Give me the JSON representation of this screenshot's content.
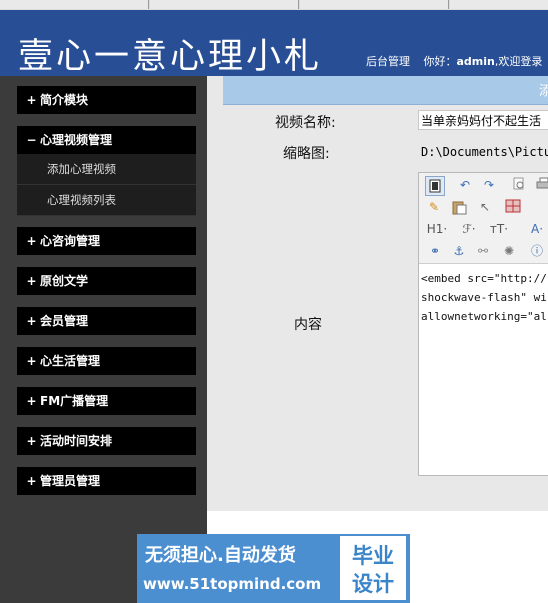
{
  "header": {
    "site_title": "壹心一意心理小札",
    "nav_admin": "后台管理",
    "greeting_prefix": "你好：",
    "username": "admin",
    "greeting_suffix": ",欢迎登录"
  },
  "sidebar": {
    "items": [
      {
        "sign": "+",
        "label": "简介模块"
      },
      {
        "sign": "−",
        "label": "心理视频管理"
      },
      {
        "sign": "+",
        "label": "心咨询管理"
      },
      {
        "sign": "+",
        "label": "原创文学"
      },
      {
        "sign": "+",
        "label": "会员管理"
      },
      {
        "sign": "+",
        "label": "心生活管理"
      },
      {
        "sign": "+",
        "label": "FM广播管理"
      },
      {
        "sign": "+",
        "label": "活动时间安排"
      },
      {
        "sign": "+",
        "label": "管理员管理"
      }
    ],
    "subitems": [
      {
        "label": "添加心理视频"
      },
      {
        "label": "心理视频列表"
      }
    ]
  },
  "main": {
    "bar_text": "添",
    "form": {
      "name_label": "视频名称:",
      "name_value": "当单亲妈妈付不起生活",
      "thumb_label": "缩略图:",
      "thumb_value": "D:\\Documents\\Pictur",
      "content_label": "内容"
    },
    "editor": {
      "toolbar": [
        [
          "source-icon",
          "undo-icon",
          "redo-icon",
          "preview-icon",
          "print-icon"
        ],
        [
          "cleanup-icon",
          "paste-icon",
          "select-icon",
          "table-icon"
        ],
        [
          "heading-icon",
          "font-family-icon",
          "font-size-icon",
          "font-color-icon"
        ],
        [
          "link-icon",
          "anchor-icon",
          "unlink-icon",
          "flash-icon",
          "help-icon"
        ]
      ],
      "toolbar_glyphs": {
        "heading": "H1·",
        "font_family": "ℱ·",
        "font_size": "тT·",
        "font_color": "A·"
      },
      "content_lines": [
        "<embed src=\"http://",
        "shockwave-flash\" wi",
        "allownetworking=\"al"
      ]
    }
  },
  "watermark": {
    "slogan": "无须担心.自动发货",
    "url": "www.51topmind.com",
    "badge_line1": "毕业",
    "badge_line2": "设计",
    "bg_color": "#4b8fd0"
  }
}
